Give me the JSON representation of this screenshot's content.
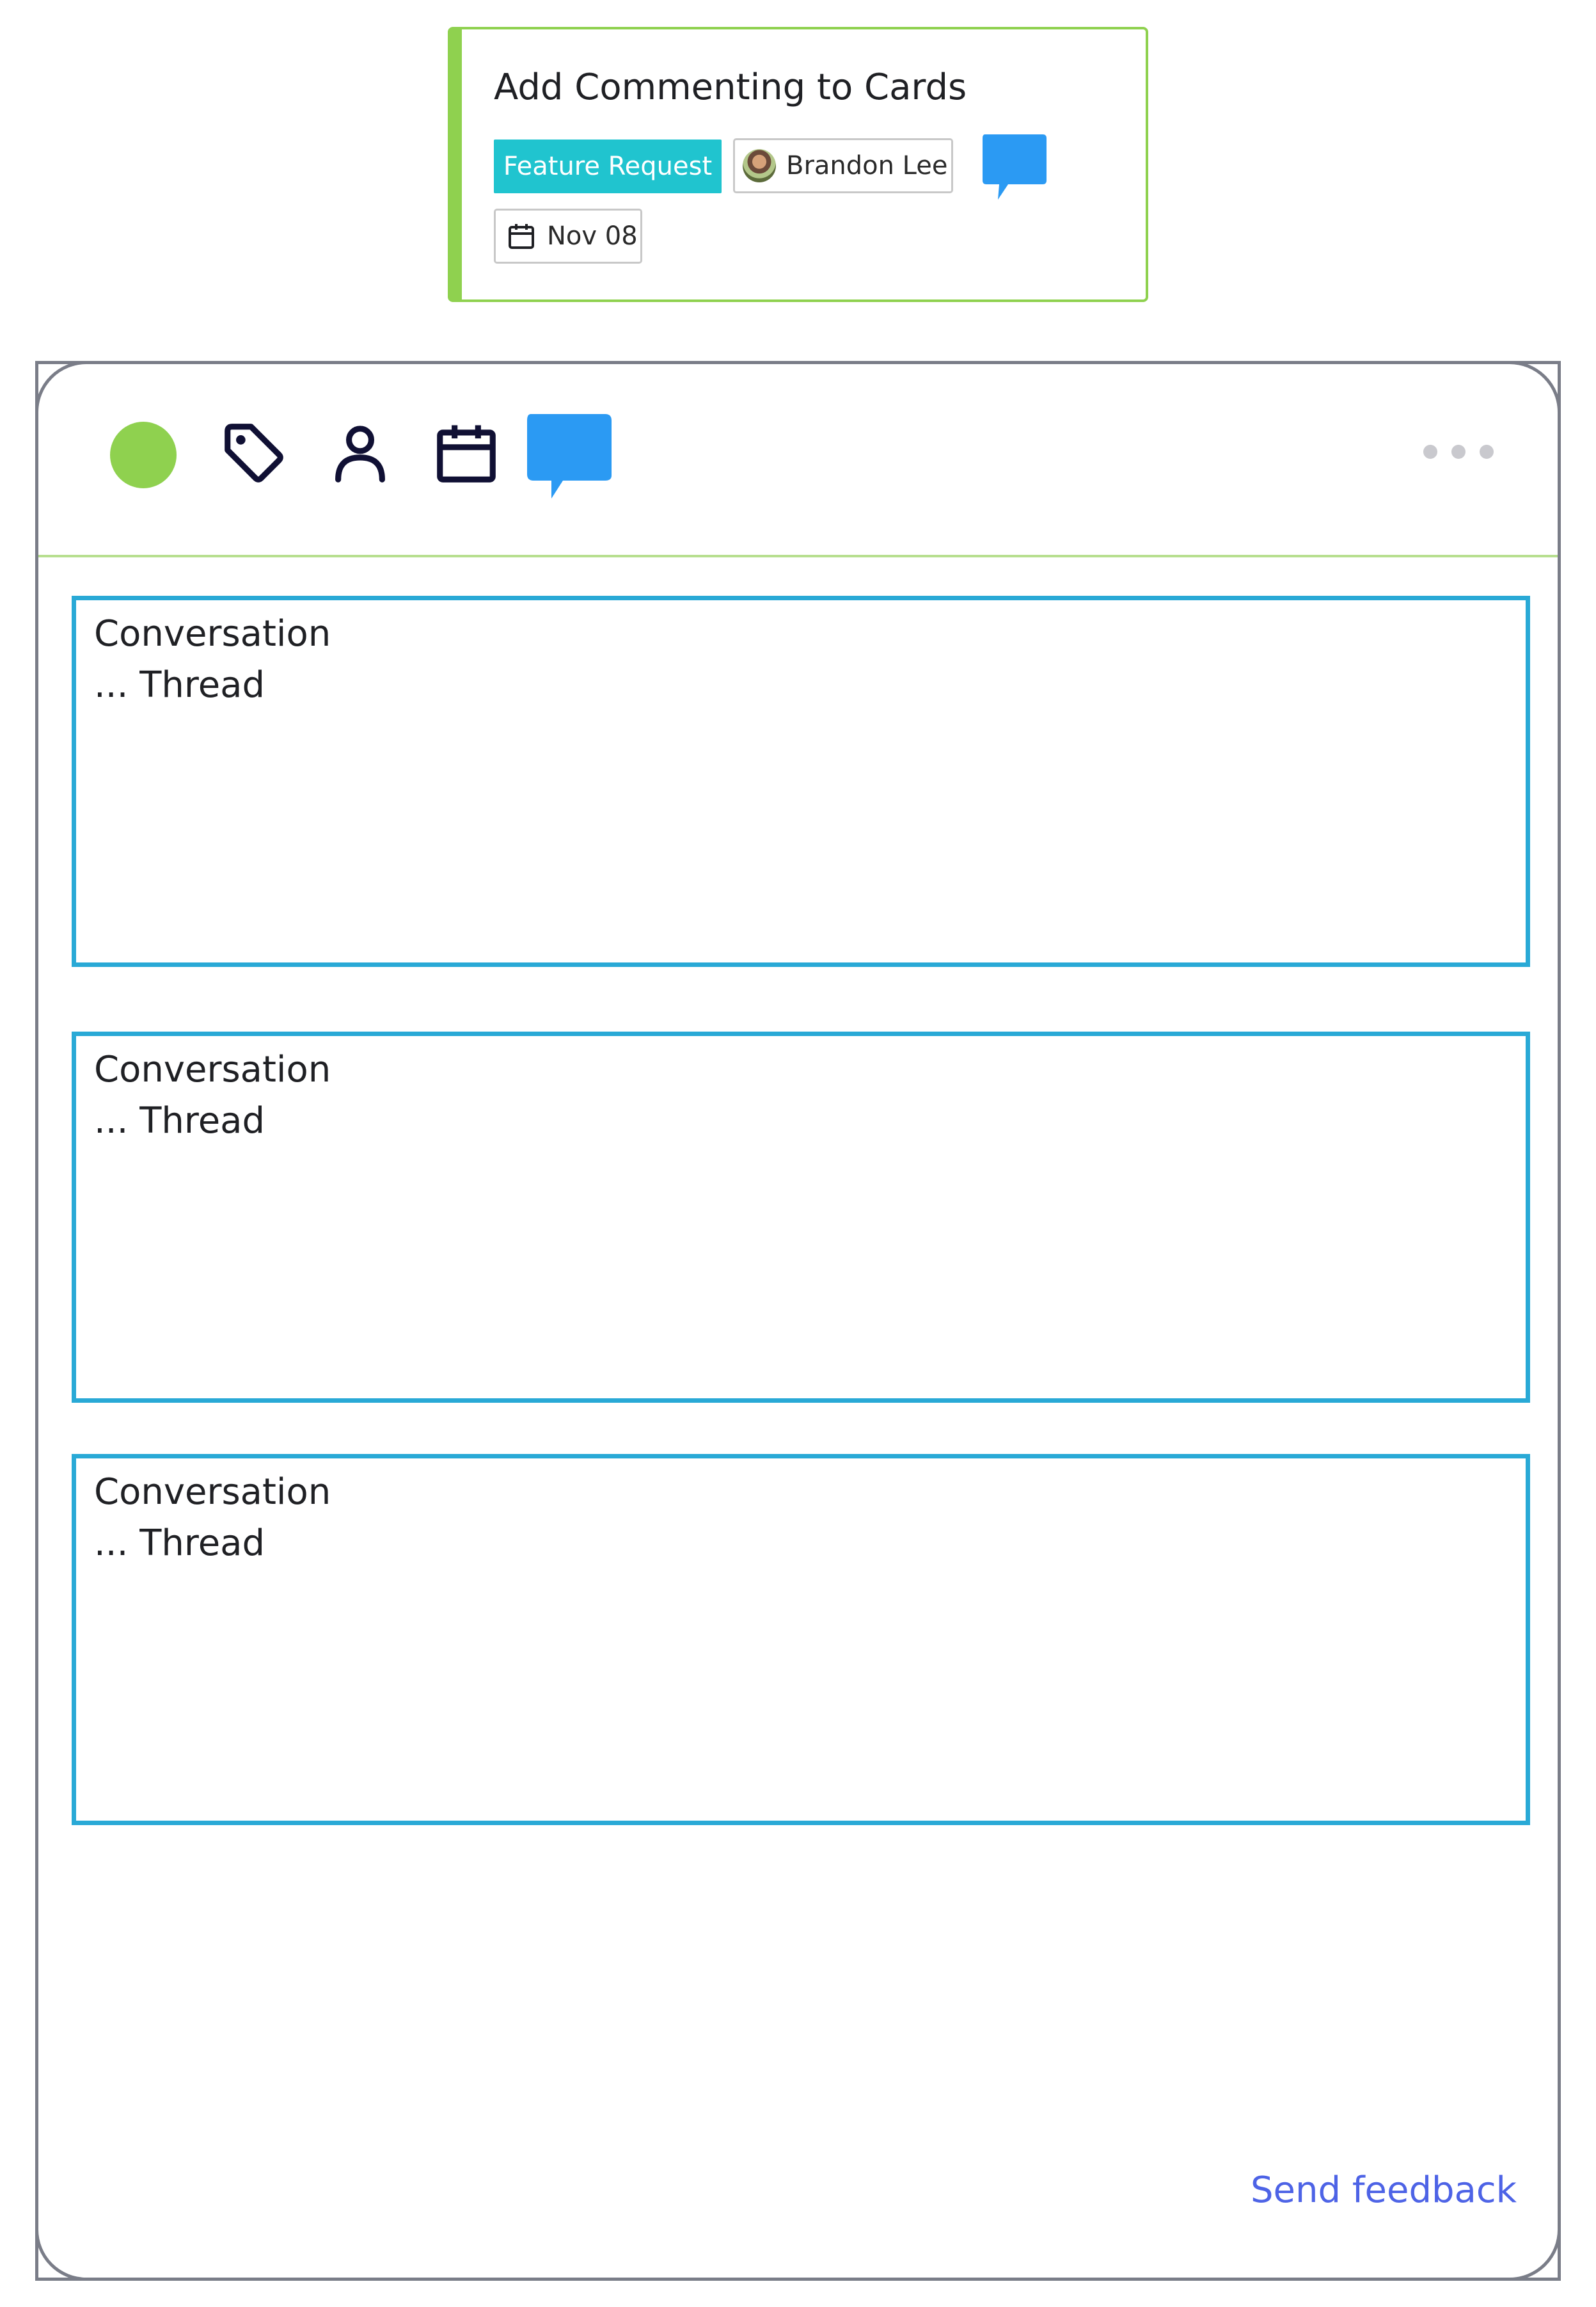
{
  "card": {
    "title": "Add Commenting to Cards",
    "tag_label": "Feature Request",
    "assignee_name": "Brandon Lee",
    "due_date": "Nov 08",
    "accent_color": "#8fd14f",
    "tag_color": "#20c4cf",
    "comment_icon": "speech-bubble-icon"
  },
  "panel": {
    "toolbar": {
      "status_color": "#8fd14f",
      "icons": [
        "status-dot",
        "tag-icon",
        "user-icon",
        "calendar-icon",
        "speech-bubble-icon",
        "more-dots-icon"
      ]
    },
    "threads": [
      {
        "line1": "Conversation",
        "line2": "... Thread"
      },
      {
        "line1": "Conversation",
        "line2": "... Thread"
      },
      {
        "line1": "Conversation",
        "line2": "... Thread"
      }
    ],
    "thread_border_color": "#29a9d6",
    "feedback_label": "Send feedback",
    "feedback_color": "#4d63e6"
  }
}
